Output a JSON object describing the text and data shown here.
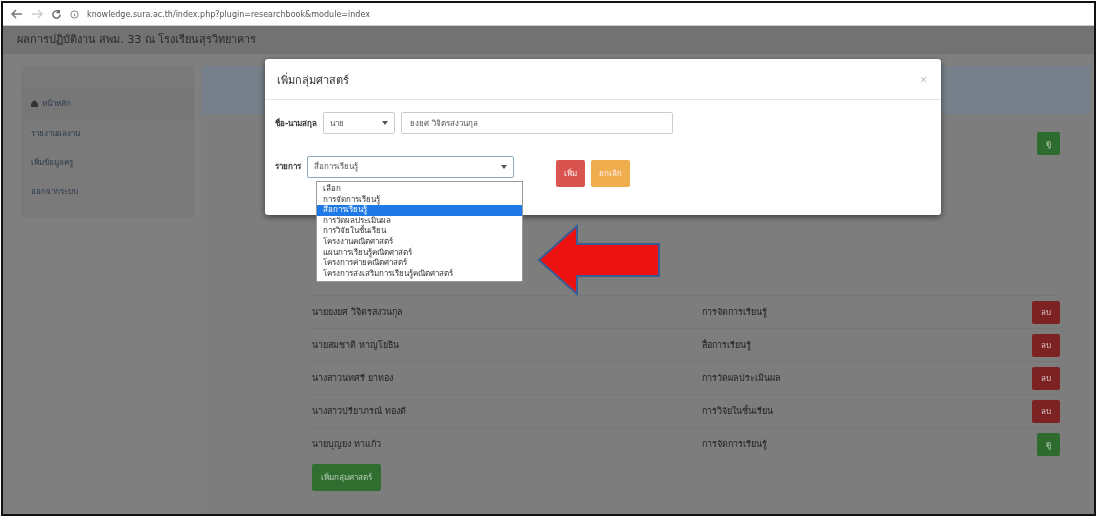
{
  "browser": {
    "url": "knowledge.sura.ac.th/index.php?plugin=researchbook&module=index"
  },
  "site_title": "ผลการปฏิบัติงาน สพม. 33 ณ โรงเรียนสุรวิทยาคาร",
  "sidebar": {
    "items": [
      {
        "label": "หน้าหลัก",
        "icon": true,
        "selected": true
      },
      {
        "label": "รายงานผลงาน",
        "icon": false,
        "selected": false
      },
      {
        "label": "เพิ่มข้อมูลครู",
        "icon": false,
        "selected": false
      },
      {
        "label": "ออกจากระบบ",
        "icon": false,
        "selected": false
      }
    ]
  },
  "table": {
    "partial_row_button": {
      "label": "ดู",
      "kind": "view"
    },
    "rows": [
      {
        "name": "นายยงยศ วิจิตรสงวนกุล",
        "category": "การจัดการเรียนรู้",
        "button": {
          "label": "ลบ",
          "kind": "delete"
        }
      },
      {
        "name": "นายสมชาติ หาญโยธิน",
        "category": "สื่อการเรียนรู้",
        "button": {
          "label": "ลบ",
          "kind": "delete"
        }
      },
      {
        "name": "นางสาวนทศรี ยาทอง",
        "category": "การวัดผลประเมินผล",
        "button": {
          "label": "ลบ",
          "kind": "delete"
        }
      },
      {
        "name": "นางสาวปรียาภรณ์ ทองดี",
        "category": "การวิจัยในชั้นเรียน",
        "button": {
          "label": "ลบ",
          "kind": "delete"
        }
      },
      {
        "name": "นายบุญยง ทาแก้ว",
        "category": "การจัดการเรียนรู้",
        "button": {
          "label": "ดู",
          "kind": "view"
        }
      }
    ],
    "add_button": "เพิ่มกลุ่มศาสตร์"
  },
  "modal": {
    "title": "เพิ่มกลุ่มศาสตร์",
    "close": "×",
    "name_label": "ชื่อ-นามสกุล",
    "prefix": "นาย",
    "name_value": "ยงยศ วิจิตรสงวนกุล",
    "item_label": "รายการ",
    "item_value": "สื่อการเรียนรู้",
    "options": [
      {
        "label": "เลือก",
        "selected": false
      },
      {
        "label": "การจัดการเรียนรู้",
        "selected": false
      },
      {
        "label": "สื่อการเรียนรู้",
        "selected": true
      },
      {
        "label": "การวัดผลประเมินผล",
        "selected": false
      },
      {
        "label": "การวิจัยในชั้นเรียน",
        "selected": false
      },
      {
        "label": "โครงงานคณิตศาสตร์",
        "selected": false
      },
      {
        "label": "แผนการเรียนรู้คณิตศาสตร์",
        "selected": false
      },
      {
        "label": "โครงการค่ายคณิตศาสตร์",
        "selected": false
      },
      {
        "label": "โครงการส่งเสริมการเรียนรู้คณิตศาสตร์",
        "selected": false
      }
    ],
    "buttons": [
      {
        "label": "เพิ่ม",
        "kind": "danger"
      },
      {
        "label": "ยกเลิก",
        "kind": "warning"
      }
    ]
  }
}
